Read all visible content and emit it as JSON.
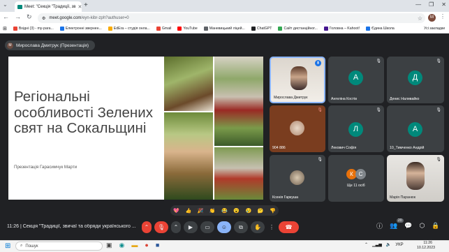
{
  "browser": {
    "tab_title": "Meet: \"Секція \"Традиції, зв",
    "tab_close": "✕",
    "new_tab": "+",
    "url_host": "meet.google.com",
    "url_path": "/eyn-kibr-zph?authuser=0",
    "profile_letter": "M",
    "bookmarks": [
      {
        "label": "Вхідні (3) - my-para...",
        "color": "#ea4335"
      },
      {
        "label": "Електронні звернен...",
        "color": "#1a73e8"
      },
      {
        "label": "EdEra – студія онла...",
        "color": "#f9ab00"
      },
      {
        "label": "Gmail",
        "color": "#ea4335"
      },
      {
        "label": "YouTube",
        "color": "#ff0000"
      },
      {
        "label": "Маневицький ліцей...",
        "color": "#5f6368"
      },
      {
        "label": "ChatGPT",
        "color": "#202124"
      },
      {
        "label": "Сайт дистанційног...",
        "color": "#34a853"
      },
      {
        "label": "Головна – Kahoot!",
        "color": "#46178f"
      },
      {
        "label": "Єдина Школа",
        "color": "#1a73e8"
      }
    ],
    "all_bookmarks": "Усі закладки"
  },
  "meet": {
    "presenter_label": "Мирослава Дмитрук (Презентація)",
    "presenter_initial": "М",
    "slide": {
      "title": "Регіональні особливості Зелених свят на Сокальщині",
      "subtitle": "Презентація Гарасимчук Марти"
    },
    "tiles": [
      {
        "name": "Мирослава Дмитрук",
        "initial": "",
        "color": ""
      },
      {
        "name": "Ангеліна Костів",
        "initial": "А",
        "color": "#00897b"
      },
      {
        "name": "Денис Наливайко",
        "initial": "Д",
        "color": "#00897b"
      },
      {
        "name": "904 886",
        "initial": "",
        "color": ""
      },
      {
        "name": "Лекович Софія",
        "initial": "Л",
        "color": "#00897b"
      },
      {
        "name": "10_Тимченко Андрій",
        "initial": "А",
        "color": "#00897b"
      },
      {
        "name": "Ксенія Гаркуша",
        "initial": "",
        "color": ""
      },
      {
        "name": "Ще 11 осіб",
        "initial": "",
        "color": ""
      },
      {
        "name": "Марія Паранюк",
        "initial": "",
        "color": ""
      }
    ],
    "more_avatars": [
      "К",
      "С"
    ],
    "reactions": [
      "💖",
      "👍",
      "🎉",
      "👏",
      "😂",
      "😮",
      "😢",
      "🤔",
      "👎"
    ],
    "time": "11:26",
    "meeting_title": "Секція \"Традиції, звичаї та обряди українського ...",
    "participant_count": "20"
  },
  "taskbar": {
    "search_placeholder": "Пошук",
    "lang": "УКР",
    "clock_time": "11:26",
    "clock_date": "10.12.2023"
  }
}
